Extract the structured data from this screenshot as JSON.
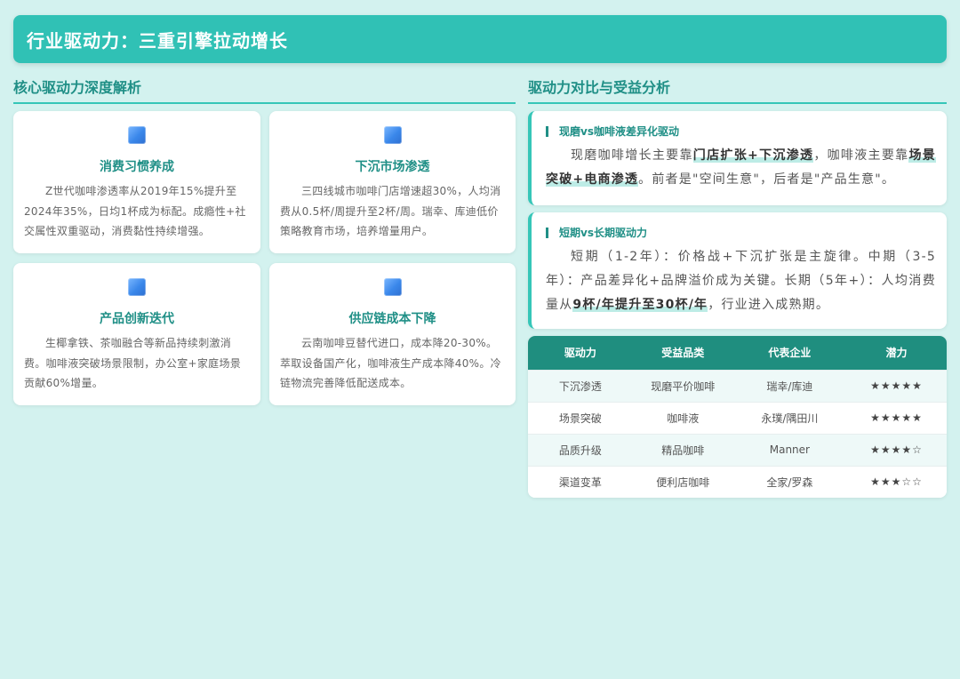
{
  "header": {
    "title": "行业驱动力：三重引擎拉动增长"
  },
  "left": {
    "section_title": "核心驱动力深度解析",
    "cards": [
      {
        "icon": "blue-square-icon",
        "title": "消费习惯养成",
        "text": "Z世代咖啡渗透率从2019年15%提升至2024年35%，日均1杯成为标配。成瘾性+社交属性双重驱动，消费黏性持续增强。"
      },
      {
        "icon": "blue-square-icon",
        "title": "下沉市场渗透",
        "text": "三四线城市咖啡门店增速超30%，人均消费从0.5杯/周提升至2杯/周。瑞幸、库迪低价策略教育市场，培养增量用户。"
      },
      {
        "icon": "blue-square-icon",
        "title": "产品创新迭代",
        "text": "生椰拿铁、茶咖融合等新品持续刺激消费。咖啡液突破场景限制，办公室+家庭场景贡献60%增量。"
      },
      {
        "icon": "blue-square-icon",
        "title": "供应链成本下降",
        "text": "云南咖啡豆替代进口，成本降20-30%。萃取设备国产化，咖啡液生产成本降40%。冷链物流完善降低配送成本。"
      }
    ]
  },
  "right": {
    "section_title": "驱动力对比与受益分析",
    "box1": {
      "title": "现磨vs咖啡液差异化驱动",
      "t1": "现磨咖啡增长主要靠",
      "h1": "门店扩张+下沉渗透",
      "t2": "，咖啡液主要靠",
      "h2": "场景突破+电商渗透",
      "t3": "。前者是\"空间生意\"，后者是\"产品生意\"。"
    },
    "box2": {
      "title": "短期vs长期驱动力",
      "t1": "短期（1-2年）：价格战+下沉扩张是主旋律。中期（3-5年）：产品差异化+品牌溢价成为关键。长期（5年+）：人均消费量从",
      "h1": "9杯/年提升至30杯/年",
      "t2": "，行业进入成熟期。"
    },
    "table": {
      "headers": [
        "驱动力",
        "受益品类",
        "代表企业",
        "潜力"
      ],
      "rows": [
        [
          "下沉渗透",
          "现磨平价咖啡",
          "瑞幸/库迪",
          "★★★★★"
        ],
        [
          "场景突破",
          "咖啡液",
          "永璞/隅田川",
          "★★★★★"
        ],
        [
          "品质升级",
          "精品咖啡",
          "Manner",
          "★★★★☆"
        ],
        [
          "渠道变革",
          "便利店咖啡",
          "全家/罗森",
          "★★★☆☆"
        ]
      ]
    }
  },
  "colors": {
    "accent": "#30c1b5",
    "dark_accent": "#1f8e7f",
    "background": "#d3f2ef"
  }
}
